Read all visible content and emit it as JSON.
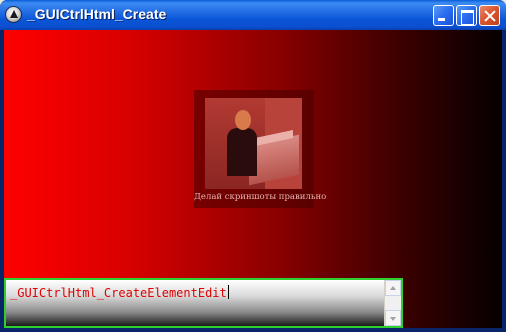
{
  "window": {
    "title": "_GUICtrlHtml_Create"
  },
  "content": {
    "photo_caption": "Делай скриншоты правильно",
    "edit_value": "_GUICtrlHtml_CreateElementEdit"
  },
  "icons": {
    "app": "autoit-icon",
    "minimize": "minimize-icon",
    "maximize": "maximize-icon",
    "close": "close-icon"
  },
  "colors": {
    "background_gradient_start": "#ff0000",
    "background_gradient_end": "#050000",
    "edit_text": "#e00000",
    "edit_border": "#2fcf2f"
  }
}
